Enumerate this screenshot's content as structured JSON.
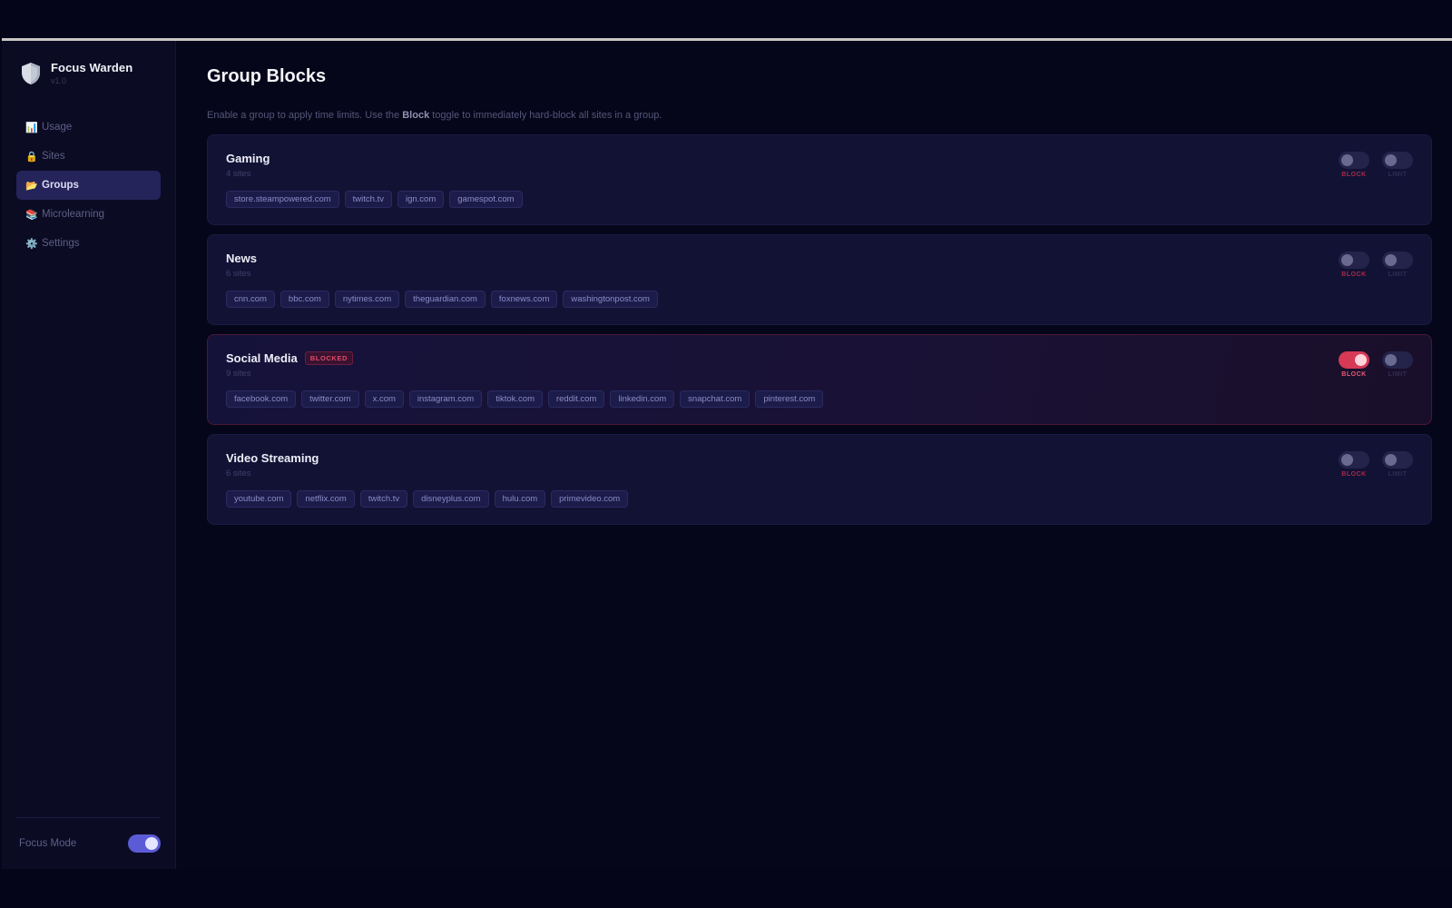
{
  "app": {
    "name": "Focus Warden",
    "version": "v1.0"
  },
  "sidebar": {
    "items": [
      {
        "icon": "📊",
        "label": "Usage",
        "active": false
      },
      {
        "icon": "🔒",
        "label": "Sites",
        "active": false
      },
      {
        "icon": "📂",
        "label": "Groups",
        "active": true
      },
      {
        "icon": "📚",
        "label": "Microlearning",
        "active": false
      },
      {
        "icon": "⚙️",
        "label": "Settings",
        "active": false
      }
    ],
    "focus_mode": {
      "label": "Focus Mode",
      "enabled": true
    }
  },
  "page": {
    "title": "Group Blocks",
    "desc_before": "Enable a group to apply time limits. Use the ",
    "desc_bold": "Block",
    "desc_after": " toggle to immediately hard-block all sites in a group."
  },
  "controls": {
    "block_label": "BLOCK",
    "limit_label": "LIMIT"
  },
  "groups": [
    {
      "name": "Gaming",
      "count": "4 sites",
      "blocked": false,
      "badge": "",
      "block_on": false,
      "limit_on": false,
      "sites": [
        "store.steampowered.com",
        "twitch.tv",
        "ign.com",
        "gamespot.com"
      ]
    },
    {
      "name": "News",
      "count": "6 sites",
      "blocked": false,
      "badge": "",
      "block_on": false,
      "limit_on": false,
      "sites": [
        "cnn.com",
        "bbc.com",
        "nytimes.com",
        "theguardian.com",
        "foxnews.com",
        "washingtonpost.com"
      ]
    },
    {
      "name": "Social Media",
      "count": "9 sites",
      "blocked": true,
      "badge": "BLOCKED",
      "block_on": true,
      "limit_on": false,
      "sites": [
        "facebook.com",
        "twitter.com",
        "x.com",
        "instagram.com",
        "tiktok.com",
        "reddit.com",
        "linkedin.com",
        "snapchat.com",
        "pinterest.com"
      ]
    },
    {
      "name": "Video Streaming",
      "count": "6 sites",
      "blocked": false,
      "badge": "",
      "block_on": false,
      "limit_on": false,
      "sites": [
        "youtube.com",
        "netflix.com",
        "twitch.tv",
        "disneyplus.com",
        "hulu.com",
        "primevideo.com"
      ]
    }
  ],
  "colors": {
    "accent": "#5b5bd6",
    "danger": "#d63a55",
    "background": "#06061a"
  }
}
